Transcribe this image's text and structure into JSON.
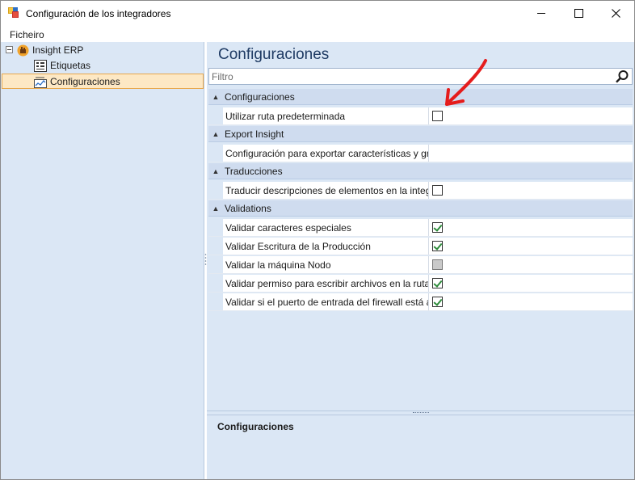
{
  "window": {
    "title": "Configuración de los integradores"
  },
  "menu": {
    "items": [
      "Ficheiro"
    ]
  },
  "tree": {
    "root": "Insight ERP",
    "children": [
      "Etiquetas",
      "Configuraciones"
    ],
    "selected": "Configuraciones"
  },
  "panel": {
    "title": "Configuraciones",
    "filter_placeholder": "Filtro",
    "help_title": "Configuraciones"
  },
  "categories": [
    {
      "label": "Configuraciones",
      "properties": [
        {
          "name": "Utilizar ruta predeterminada",
          "type": "checkbox",
          "state": "unchecked"
        }
      ]
    },
    {
      "label": "Export Insight",
      "properties": [
        {
          "name": "Configuración para exportar características y gru...",
          "type": "text",
          "value": ""
        }
      ]
    },
    {
      "label": "Traducciones",
      "properties": [
        {
          "name": "Traducir descripciones de elementos en la integr...",
          "type": "checkbox",
          "state": "unchecked"
        }
      ]
    },
    {
      "label": "Validations",
      "properties": [
        {
          "name": "Validar caracteres especiales",
          "type": "checkbox",
          "state": "checked"
        },
        {
          "name": "Validar Escritura de la Producción",
          "type": "checkbox",
          "state": "checked"
        },
        {
          "name": "Validar la máquina Nodo",
          "type": "checkbox",
          "state": "indeterminate"
        },
        {
          "name": "Validar permiso para escribir archivos en la ruta...",
          "type": "checkbox",
          "state": "checked"
        },
        {
          "name": "Validar si el puerto de entrada del firewall está a...",
          "type": "checkbox",
          "state": "checked"
        }
      ]
    }
  ],
  "colors": {
    "panel_bg": "#dbe7f5",
    "category_bg": "#cfdcef",
    "selection_bg": "#fde8c4",
    "selection_border": "#e8a84c",
    "check_green": "#2e8b3b",
    "annotation_red": "#e51c1c"
  }
}
